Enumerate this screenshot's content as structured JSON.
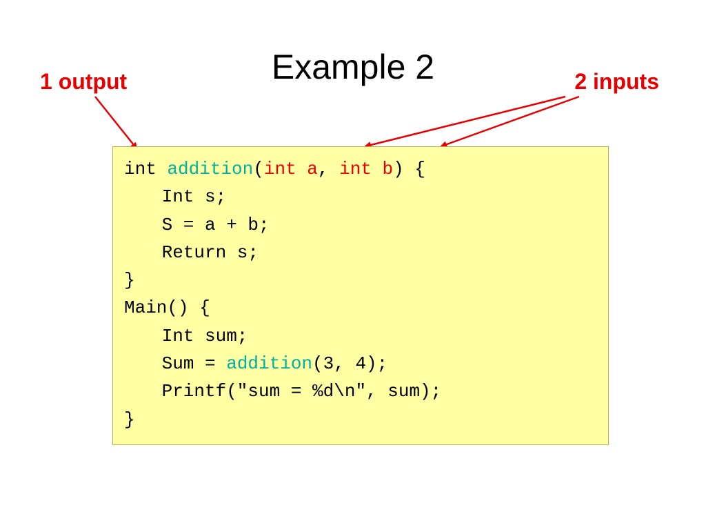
{
  "title": "Example 2",
  "annotations": {
    "left": "1 output",
    "right": "2 inputs"
  },
  "code": {
    "l1_int": "int ",
    "l1_addition": "addition",
    "l1_paren_open": "(",
    "l1_int_a": "int a",
    "l1_comma": ", ",
    "l1_int_b": "int b",
    "l1_paren_close_brace": ") {",
    "l2": "Int s;",
    "l3": "S = a + b;",
    "l4": "Return s;",
    "l5": "}",
    "l6": "Main() {",
    "l7": "Int sum;",
    "l8_prefix": "Sum = ",
    "l8_addition": "addition",
    "l8_suffix": "(3, 4);",
    "l9": "Printf(\"sum = %d\\n\", sum);",
    "l10": "}"
  },
  "colors": {
    "annotation": "#e80000",
    "code_bg": "#ffffa3",
    "keyword_teal": "#00b0a0",
    "param_red": "#e80000"
  }
}
